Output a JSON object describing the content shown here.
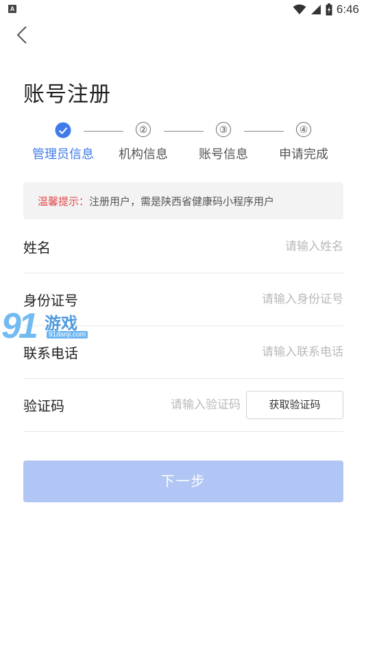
{
  "status_bar": {
    "notification_icon": "A",
    "time": "6:46",
    "icons": [
      "wifi-icon",
      "signal-icon",
      "battery-icon"
    ]
  },
  "page": {
    "title": "账号注册"
  },
  "steps": [
    {
      "marker": "",
      "label": "管理员信息",
      "state": "done"
    },
    {
      "marker": "②",
      "label": "机构信息",
      "state": "todo"
    },
    {
      "marker": "③",
      "label": "账号信息",
      "state": "todo"
    },
    {
      "marker": "④",
      "label": "申请完成",
      "state": "todo"
    }
  ],
  "tip": {
    "label": "温馨提示：",
    "text": "注册用户，需是陕西省健康码小程序用户"
  },
  "form": {
    "name": {
      "label": "姓名",
      "placeholder": "请输入姓名",
      "value": ""
    },
    "id_number": {
      "label": "身份证号",
      "placeholder": "请输入身份证号",
      "value": ""
    },
    "phone": {
      "label": "联系电话",
      "placeholder": "请输入联系电话",
      "value": ""
    },
    "code": {
      "label": "验证码",
      "placeholder": "请输入验证码",
      "value": "",
      "button": "获取验证码"
    }
  },
  "next_button": {
    "label": "下一步",
    "enabled": false
  },
  "watermark": {
    "logo": "91",
    "name": "游戏",
    "url": "91danji.com"
  },
  "colors": {
    "accent": "#3f7bea",
    "button_disabled": "#b1c6f4",
    "tip_label": "#e04a4a",
    "tip_background": "#f3f3f3"
  }
}
